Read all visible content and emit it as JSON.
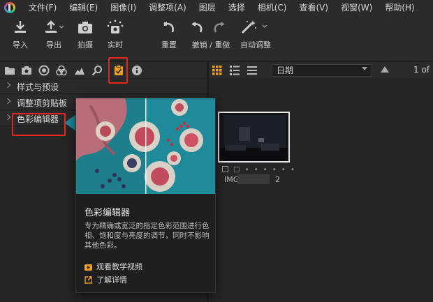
{
  "menubar": {
    "items": [
      "文件(F)",
      "编辑(E)",
      "图像(I)",
      "调整项(A)",
      "图层",
      "选择",
      "相机(C)",
      "查看(V)",
      "视窗(W)",
      "帮助(H)"
    ]
  },
  "toolbar": {
    "import_label": "导入",
    "export_label": "导出",
    "capture_label": "拍摄",
    "live_label": "实时",
    "reset_label": "重置",
    "undo_redo_label": "撤销 / 重做",
    "auto_adjust_label": "自动调整"
  },
  "browser": {
    "sort_value": "日期",
    "page_count": "1 of",
    "thumb_dots": "□ • • • • • •",
    "thumb_name_prefix": "IMG",
    "thumb_name_suffix": "2"
  },
  "panel": {
    "items": [
      {
        "label": "样式与预设"
      },
      {
        "label": "调整项剪贴板"
      },
      {
        "label": "色彩编辑器"
      }
    ]
  },
  "popover": {
    "title": "色彩编辑器",
    "description": "专为精确或宽泛的指定色彩范围进行色相、饱和度与亮度的调节，同时不影响其他色彩。",
    "video_link": "观看教学视频",
    "details_link": "了解详情"
  },
  "colors": {
    "highlight": "#e3261b",
    "active_tab": "#f0a020",
    "video_icon": "#f0a020",
    "teal": "#1f8a99"
  }
}
